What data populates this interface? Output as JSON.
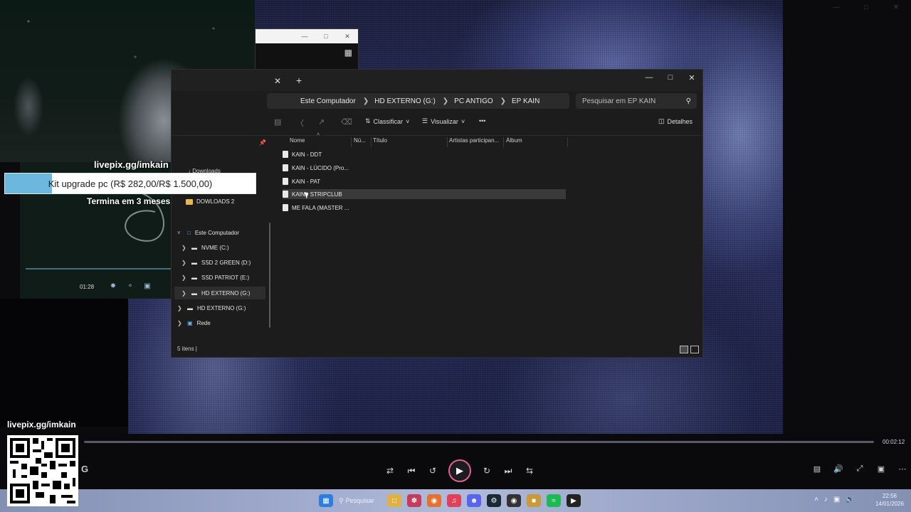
{
  "overlay": {
    "livepix_url_top": "livepix.gg/imkain",
    "goal_text": "Kit upgrade pc (R$ 282,00/R$ 1.500,00)",
    "goal_progress": 0.188,
    "goal_subtitle": "Termina em 3 meses",
    "livepix_url_qr": "livepix.gg/imkain",
    "cam_time": "01:28"
  },
  "explorer": {
    "breadcrumb": [
      "Este Computador",
      "HD EXTERNO (G:)",
      "PC ANTIGO",
      "EP KAIN"
    ],
    "search_placeholder": "Pesquisar em EP KAIN",
    "toolbar": {
      "sort_label": "Classificar",
      "view_label": "Visualizar",
      "more_label": "•••",
      "details_label": "Detalhes"
    },
    "nav": {
      "downloads": "Downloads",
      "downloads2": "DOWLOADS 2",
      "this_pc": "Este Computador",
      "drives": [
        {
          "label": "NVME (C:)"
        },
        {
          "label": "SSD 2 GREEN (D:)"
        },
        {
          "label": "SSD PATRIOT (E:)"
        },
        {
          "label": "HD EXTERNO (G:)"
        }
      ],
      "hd_externo": "HD EXTERNO (G:)",
      "network": "Rede"
    },
    "columns": [
      "Nome",
      "Nú...",
      "Título",
      "Artistas participan...",
      "Álbum"
    ],
    "files": [
      {
        "name": "KAIN - DDT"
      },
      {
        "name": "KAIN - LÚCIDO (Pro..."
      },
      {
        "name": "KAIN - PAT"
      },
      {
        "name": "KAIN - STRIPCLUB"
      },
      {
        "name": "ME FALA (MASTER ..."
      }
    ],
    "status": "5 itens  |"
  },
  "player": {
    "elapsed": "00:02:12",
    "left_label": "G"
  },
  "taskbar": {
    "search_label": "Pesquisar",
    "time": "22:56",
    "date": "14/01/2026"
  },
  "colors": {
    "accent_pink": "#e5618f",
    "goal_blue": "#6bb7dd",
    "folder_yellow": "#e8b84a"
  }
}
